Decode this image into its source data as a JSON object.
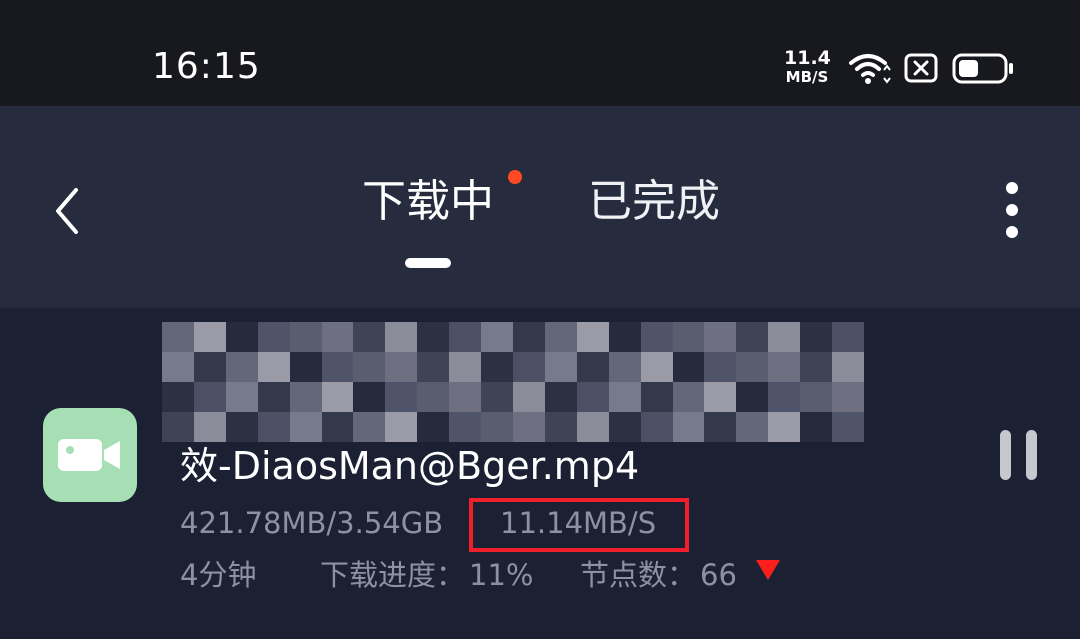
{
  "status_bar": {
    "time": "16:15",
    "net_speed": "11.4",
    "net_speed_unit": "MB/S",
    "icons": [
      "wifi-icon",
      "sim-icon",
      "battery-icon"
    ]
  },
  "header": {
    "tabs": [
      {
        "label": "下载中",
        "active": true,
        "has_dot": true
      },
      {
        "label": "已完成",
        "active": false
      }
    ],
    "icons": [
      "back-icon",
      "more-icon"
    ]
  },
  "download": {
    "file_name_visible": "效-DiaosMan@Bger.mp4",
    "size": "421.78MB/3.54GB",
    "speed": "11.14MB/S",
    "time_left": "4分钟",
    "progress_label": "下载进度：",
    "progress_value": "11%",
    "nodes_label": "节点数：",
    "nodes_value": "66",
    "icons": [
      "video-icon",
      "pause-icon",
      "down-arrow-icon"
    ]
  },
  "colors": {
    "status_bar_bg": "#18191e",
    "header_bg": "#262c3e",
    "list_bg": "#1b2033",
    "accent_dot": "#ff4a23",
    "highlight_box": "#f0202a",
    "file_icon_bg": "#a7dfb4",
    "meta_text": "#8d92a0"
  }
}
